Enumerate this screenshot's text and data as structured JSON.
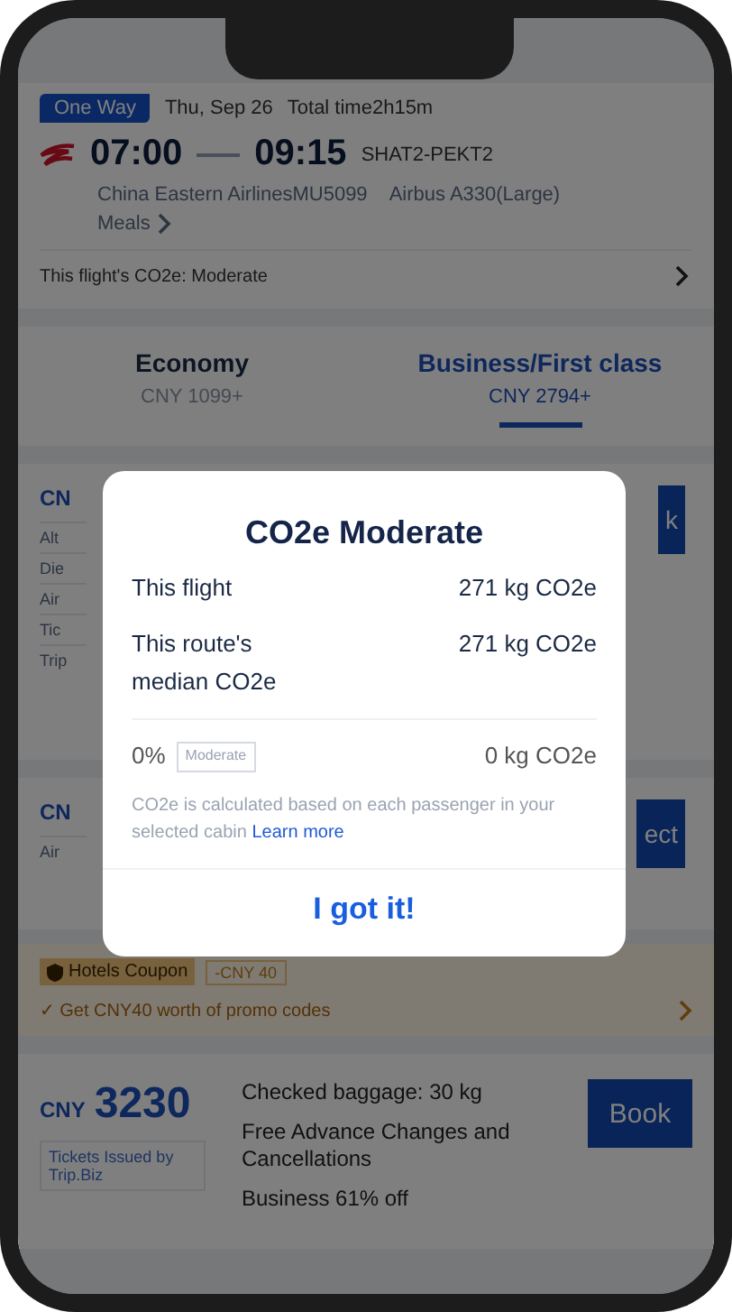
{
  "flight": {
    "trip_type": "One Way",
    "date": "Thu, Sep 26",
    "total_time": "Total time2h15m",
    "depart": "07:00",
    "arrive": "09:15",
    "route": "SHAT2-PEKT2",
    "airline_info": "China Eastern AirlinesMU5099",
    "aircraft": "Airbus A330(Large)",
    "meals": "Meals",
    "co2_line": "This flight's CO2e: Moderate"
  },
  "cabin_tabs": [
    {
      "label": "Economy",
      "price": "CNY 1099+",
      "selected": false
    },
    {
      "label": "Business/First class",
      "price": "CNY 2794+",
      "selected": true
    }
  ],
  "fare_stubs": [
    {
      "price": "CN",
      "details": [
        "Alt",
        "Die",
        "Air",
        "Tic",
        "Trip"
      ],
      "button": "k"
    },
    {
      "price": "CN",
      "details": [
        "Air"
      ],
      "button": "ect"
    }
  ],
  "coupon": {
    "badge": "Hotels Coupon",
    "amount": "-CNY 40",
    "promo": "✓ Get CNY40 worth of promo codes"
  },
  "fare": {
    "currency": "CNY",
    "amount": "3230",
    "issuer": "Tickets Issued by Trip.Biz",
    "features": [
      "Checked baggage: 30 kg",
      "Free Advance Changes and Cancellations",
      "Business 61% off"
    ],
    "button": "Book"
  },
  "dialog": {
    "title": "CO2e Moderate",
    "rows": [
      {
        "label": "This flight",
        "value": "271 kg CO2e"
      },
      {
        "label": "This route's median CO2e",
        "value": "271 kg CO2e"
      }
    ],
    "percent": "0%",
    "tag": "Moderate",
    "difference": "0 kg CO2e",
    "note": "CO2e is calculated based on each passenger in your selected cabin",
    "link": "Learn more",
    "button": "I got it!"
  }
}
